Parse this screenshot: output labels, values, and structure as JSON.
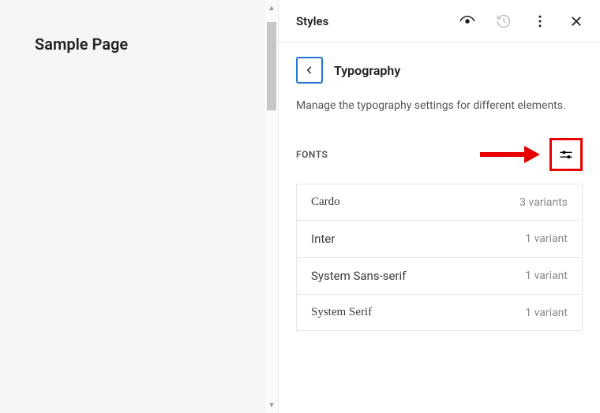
{
  "preview": {
    "title": "Sample Page"
  },
  "sidebar": {
    "header_title": "Styles",
    "panel_title": "Typography",
    "panel_desc": "Manage the typography settings for different elements.",
    "fonts_section_label": "FONTS",
    "fonts": [
      {
        "name": "Cardo",
        "variants": "3 variants",
        "serif": true
      },
      {
        "name": "Inter",
        "variants": "1 variant",
        "serif": false
      },
      {
        "name": "System Sans-serif",
        "variants": "1 variant",
        "serif": false
      },
      {
        "name": "System Serif",
        "variants": "1 variant",
        "serif": true
      }
    ]
  }
}
